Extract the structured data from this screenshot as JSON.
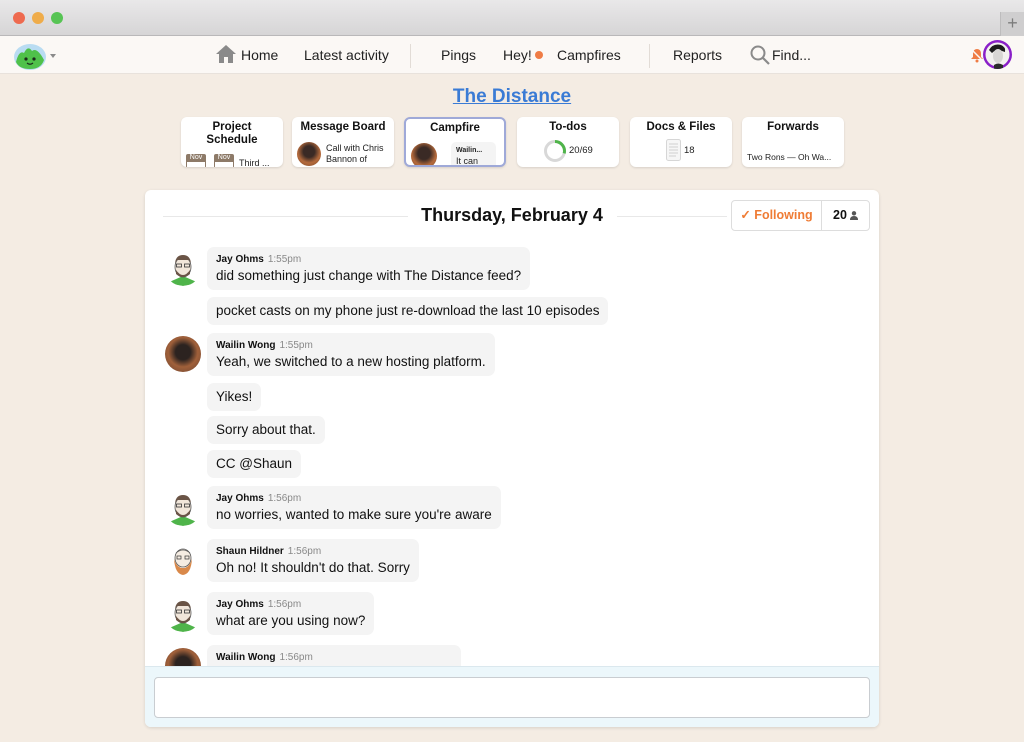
{
  "window": {
    "controls": [
      "close",
      "minimize",
      "zoom"
    ],
    "new_tab_label": "+"
  },
  "nav": {
    "logo": "basecamp-logo",
    "items": [
      {
        "label": "Home",
        "icon": "home-icon"
      },
      {
        "label": "Latest activity"
      },
      {
        "label": "Pings"
      },
      {
        "label": "Hey!",
        "badge": "unread-dot"
      },
      {
        "label": "Campfires"
      },
      {
        "label": "Reports"
      },
      {
        "label": "Find...",
        "icon": "search-icon"
      }
    ],
    "notifications": "bell-muted-icon",
    "colors": {
      "unread_dot": "#ef7c45",
      "avatar_ring": "#8a1fc8"
    }
  },
  "project": {
    "title": "The Distance",
    "title_color": "#3a7bd5"
  },
  "tools": [
    {
      "title": "Project Schedule",
      "chips": [
        {
          "month": "Nov"
        },
        {
          "month": "Nov"
        }
      ],
      "preview": "Third ..."
    },
    {
      "title": "Message Board",
      "preview_line1": "Call with Chris",
      "preview_line2": "Bannon of"
    },
    {
      "title": "Campfire",
      "preview_author": "Wailin...",
      "preview_text": "It can",
      "active": true
    },
    {
      "title": "To-dos",
      "progress_text": "20/69",
      "completed": 20,
      "total": 69
    },
    {
      "title": "Docs & Files",
      "count": "18"
    },
    {
      "title": "Forwards",
      "preview": "Two Rons — Oh Wa..."
    }
  ],
  "chat": {
    "date": "Thursday, February 4",
    "following_label": "✓ Following",
    "subscriber_count": "20",
    "follow_color": "#ef7c35",
    "messages": [
      {
        "author": "Jay Ohms",
        "time": "1:55pm",
        "text": "did something just change with The Distance feed?"
      },
      {
        "text": "pocket casts on my phone just re-download the last 10 episodes"
      },
      {
        "author": "Wailin Wong",
        "time": "1:55pm",
        "text": "Yeah, we switched to a new hosting platform."
      },
      {
        "text": "Yikes!"
      },
      {
        "text": "Sorry about that."
      },
      {
        "text": "CC @Shaun"
      },
      {
        "author": "Jay Ohms",
        "time": "1:56pm",
        "text": "no worries, wanted to make sure you're aware"
      },
      {
        "author": "Shaun Hildner",
        "time": "1:56pm",
        "text": "Oh no! It shouldn't do that. Sorry"
      },
      {
        "author": "Jay Ohms",
        "time": "1:56pm",
        "text": "what are you using now?"
      },
      {
        "author": "Wailin Wong",
        "time": "1:56pm",
        "text": ""
      }
    ],
    "composer_value": ""
  }
}
